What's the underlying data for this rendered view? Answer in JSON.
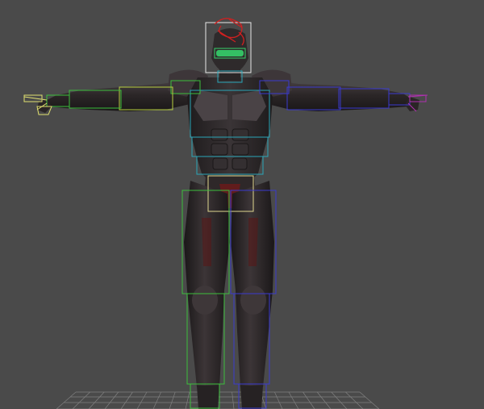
{
  "viewport": {
    "background_color": "#4a4a4a",
    "grid_color": "#8a8a8a"
  },
  "model": {
    "body_color": "#2b2628",
    "armor_highlight": "#5a5458",
    "accent_red": "#6a1a1a",
    "visor_color": "#35d06a"
  },
  "rig": {
    "head_box_color": "#e8e8e8",
    "head_helper_color": "#d02020",
    "spine_color": "#2aa6b8",
    "pelvis_color": "#e0d890",
    "left_side_color": "#3cbf3c",
    "right_side_color": "#3a3acf",
    "left_hand_color": "#e0e070",
    "right_hand_color": "#b030b0",
    "arm_upper_left_color": "#b8d040"
  }
}
